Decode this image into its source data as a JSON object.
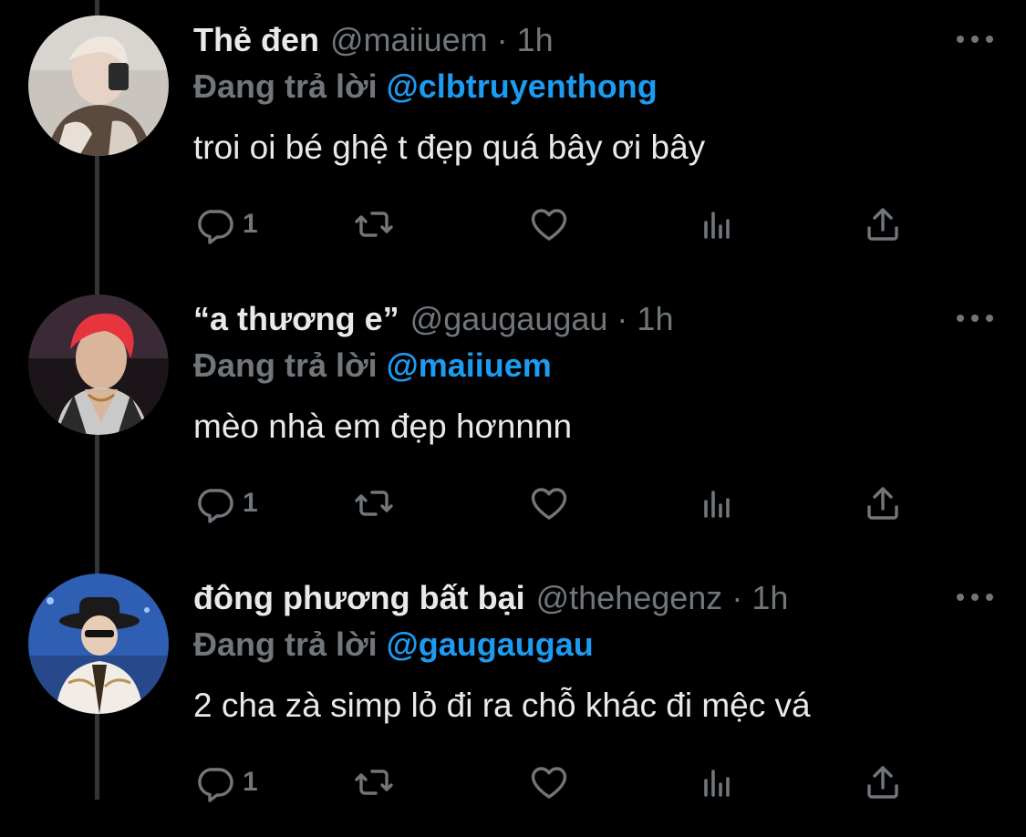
{
  "tweets": [
    {
      "display_name": "Thẻ đen",
      "handle": "@maiiuem",
      "separator": "·",
      "time": "1h",
      "reply_prefix": "Đang trả lời",
      "reply_target": "@clbtruyenthong",
      "text": "troi oi bé ghệ t đẹp quá bây ơi bây",
      "reply_count": "1"
    },
    {
      "display_name": "“a thương e”",
      "handle": "@gaugaugau",
      "separator": "·",
      "time": "1h",
      "reply_prefix": "Đang trả lời",
      "reply_target": "@maiiuem",
      "text": "mèo nhà em đẹp hơnnnn",
      "reply_count": "1"
    },
    {
      "display_name": "đông phương bất bại",
      "handle": "@thehegenz",
      "separator": "·",
      "time": "1h",
      "reply_prefix": "Đang trả lời",
      "reply_target": "@gaugaugau",
      "text": "2 cha zà simp lỏ đi ra chỗ khác đi mệc vá",
      "reply_count": "1"
    }
  ],
  "colors": {
    "background": "#000000",
    "primary_text": "#e7e9ea",
    "secondary_text": "#71767b",
    "link": "#1d9bf0",
    "thread_line": "#333639"
  }
}
